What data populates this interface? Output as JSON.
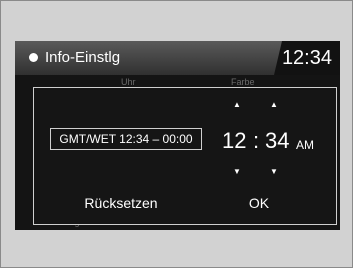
{
  "header": {
    "title": "Info-Einstlg",
    "clock": "12:34"
  },
  "background_labels": {
    "top_left": "Uhr",
    "top_right": "Farbe",
    "bottom_left": "Vorgabe",
    "bottom_right": "OK"
  },
  "dialog": {
    "timezone_label": "GMT/WET 12:34 – 00:00",
    "hour": "12",
    "separator": ":",
    "minute": "34",
    "ampm": "AM",
    "reset_label": "Rücksetzen",
    "ok_label": "OK"
  },
  "icons": {
    "hour_up": "▲",
    "hour_down": "▼",
    "minute_up": "▲",
    "minute_down": "▼"
  }
}
